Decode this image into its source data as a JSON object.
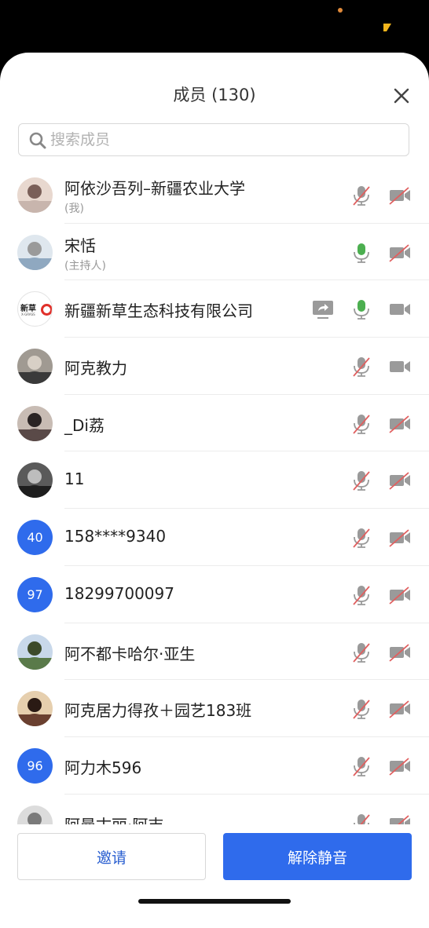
{
  "header": {
    "title": "成员 (130)"
  },
  "search": {
    "placeholder": "搜索成员"
  },
  "members": [
    {
      "name": "阿依沙吾列–新疆农业大学",
      "sub": "(我)",
      "mic": "muted",
      "cam": "off"
    },
    {
      "name": "宋恬",
      "sub": "(主持人)",
      "mic": "on",
      "cam": "off"
    },
    {
      "name": "新疆新草生态科技有限公司",
      "mic": "on",
      "cam": "on",
      "sharing": true,
      "logo": {
        "text": "新草",
        "subtext": "X-GRASS"
      }
    },
    {
      "name": "阿克教力",
      "mic": "muted",
      "cam": "on"
    },
    {
      "name": "_Di荔",
      "mic": "muted",
      "cam": "off"
    },
    {
      "name": "11",
      "mic": "muted",
      "cam": "off"
    },
    {
      "name": "158****9340",
      "avatar_text": "40",
      "mic": "muted",
      "cam": "off"
    },
    {
      "name": "18299700097",
      "avatar_text": "97",
      "mic": "muted",
      "cam": "off"
    },
    {
      "name": "阿不都卡哈尔·亚生",
      "mic": "muted",
      "cam": "off"
    },
    {
      "name": "阿克居力得孜＋园艺183班",
      "mic": "muted",
      "cam": "off"
    },
    {
      "name": "阿力木596",
      "avatar_text": "96",
      "mic": "muted",
      "cam": "off"
    },
    {
      "name": "阿曼古丽·阿吉",
      "mic": "muted",
      "cam": "off"
    }
  ],
  "footer": {
    "invite_label": "邀请",
    "unmute_label": "解除静音"
  },
  "colors": {
    "accent": "#2f6bec",
    "mic_on": "#4caf50",
    "muted_slash": "#e06060",
    "icon_gray": "#9a9a9a"
  }
}
